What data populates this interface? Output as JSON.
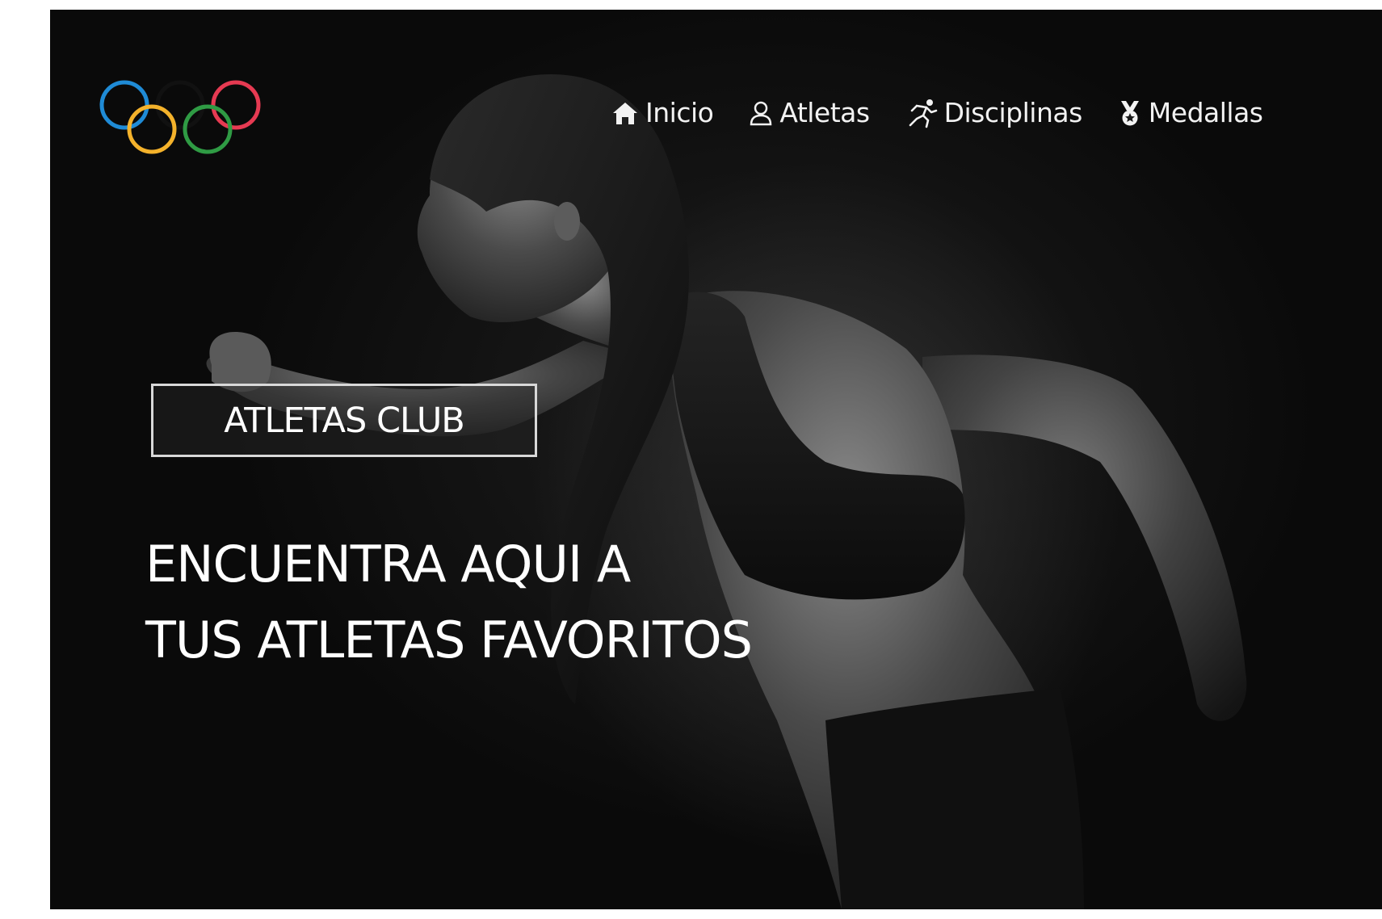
{
  "logo": {
    "icon": "olympic-rings-icon",
    "colors": [
      "#1f8bd6",
      "#111111",
      "#e63a52",
      "#f4b22b",
      "#2f9b44"
    ]
  },
  "nav": {
    "items": [
      {
        "label": "Inicio",
        "icon": "home-icon"
      },
      {
        "label": "Atletas",
        "icon": "user-icon"
      },
      {
        "label": "Disciplinas",
        "icon": "runner-icon"
      },
      {
        "label": "Medallas",
        "icon": "medal-icon"
      }
    ]
  },
  "hero": {
    "badge": "ATLETAS CLUB",
    "headline_line1": "ENCUENTRA AQUI A",
    "headline_line2": "TUS ATLETAS FAVORITOS"
  }
}
